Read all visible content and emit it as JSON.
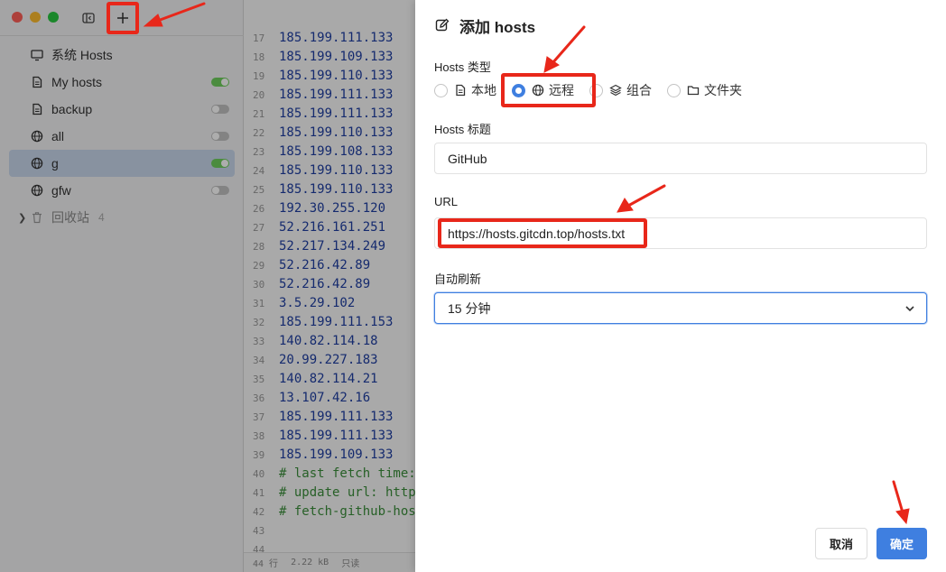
{
  "sidebar": {
    "items": [
      {
        "label": "系统 Hosts",
        "icon": "monitor-icon",
        "toggle": null,
        "active": false
      },
      {
        "label": "My hosts",
        "icon": "file-icon",
        "toggle": "on",
        "active": false
      },
      {
        "label": "backup",
        "icon": "file-icon",
        "toggle": "off",
        "active": false
      },
      {
        "label": "all",
        "icon": "globe-icon",
        "toggle": "off",
        "active": false
      },
      {
        "label": "g",
        "icon": "globe-icon",
        "toggle": "on",
        "active": true
      },
      {
        "label": "gfw",
        "icon": "globe-icon",
        "toggle": "off",
        "active": false
      }
    ],
    "trash": {
      "label": "回收站",
      "count": "4"
    }
  },
  "editor": {
    "lines": [
      {
        "n": "17",
        "t": "185.199.111.133",
        "c": false
      },
      {
        "n": "18",
        "t": "185.199.109.133",
        "c": false
      },
      {
        "n": "19",
        "t": "185.199.110.133",
        "c": false
      },
      {
        "n": "20",
        "t": "185.199.111.133",
        "c": false
      },
      {
        "n": "21",
        "t": "185.199.111.133",
        "c": false
      },
      {
        "n": "22",
        "t": "185.199.110.133",
        "c": false
      },
      {
        "n": "23",
        "t": "185.199.108.133",
        "c": false
      },
      {
        "n": "24",
        "t": "185.199.110.133",
        "c": false
      },
      {
        "n": "25",
        "t": "185.199.110.133",
        "c": false
      },
      {
        "n": "26",
        "t": "192.30.255.120",
        "c": false
      },
      {
        "n": "27",
        "t": "52.216.161.251",
        "c": false
      },
      {
        "n": "28",
        "t": "52.217.134.249",
        "c": false
      },
      {
        "n": "29",
        "t": "52.216.42.89",
        "c": false
      },
      {
        "n": "30",
        "t": "52.216.42.89",
        "c": false
      },
      {
        "n": "31",
        "t": "3.5.29.102",
        "c": false
      },
      {
        "n": "32",
        "t": "185.199.111.153",
        "c": false
      },
      {
        "n": "33",
        "t": "140.82.114.18",
        "c": false
      },
      {
        "n": "34",
        "t": "20.99.227.183",
        "c": false
      },
      {
        "n": "35",
        "t": "140.82.114.21",
        "c": false
      },
      {
        "n": "36",
        "t": "13.107.42.16",
        "c": false
      },
      {
        "n": "37",
        "t": "185.199.111.133",
        "c": false
      },
      {
        "n": "38",
        "t": "185.199.111.133",
        "c": false
      },
      {
        "n": "39",
        "t": "185.199.109.133",
        "c": false
      },
      {
        "n": "40",
        "t": "# last fetch time:",
        "c": true
      },
      {
        "n": "41",
        "t": "# update url: http",
        "c": true
      },
      {
        "n": "42",
        "t": "# fetch-github-hos",
        "c": true
      },
      {
        "n": "43",
        "t": "",
        "c": false
      },
      {
        "n": "44",
        "t": "",
        "c": false
      }
    ],
    "status": {
      "lines": "44 行",
      "size": "2.22 kB",
      "mode": "只读"
    }
  },
  "drawer": {
    "title": "添加 hosts",
    "type_label": "Hosts 类型",
    "types": [
      {
        "label": "本地",
        "icon": "file-icon",
        "checked": false
      },
      {
        "label": "远程",
        "icon": "globe-icon",
        "checked": true
      },
      {
        "label": "组合",
        "icon": "layers-icon",
        "checked": false
      },
      {
        "label": "文件夹",
        "icon": "folder-icon",
        "checked": false
      }
    ],
    "title_label": "Hosts 标题",
    "title_value": "GitHub",
    "url_label": "URL",
    "url_value": "https://hosts.gitcdn.top/hosts.txt",
    "refresh_label": "自动刷新",
    "refresh_value": "15 分钟",
    "cancel_label": "取消",
    "ok_label": "确定"
  },
  "colors": {
    "accent": "#3f7fe0",
    "annotation": "#e8271a",
    "toggle_on": "#6fcf5e"
  }
}
